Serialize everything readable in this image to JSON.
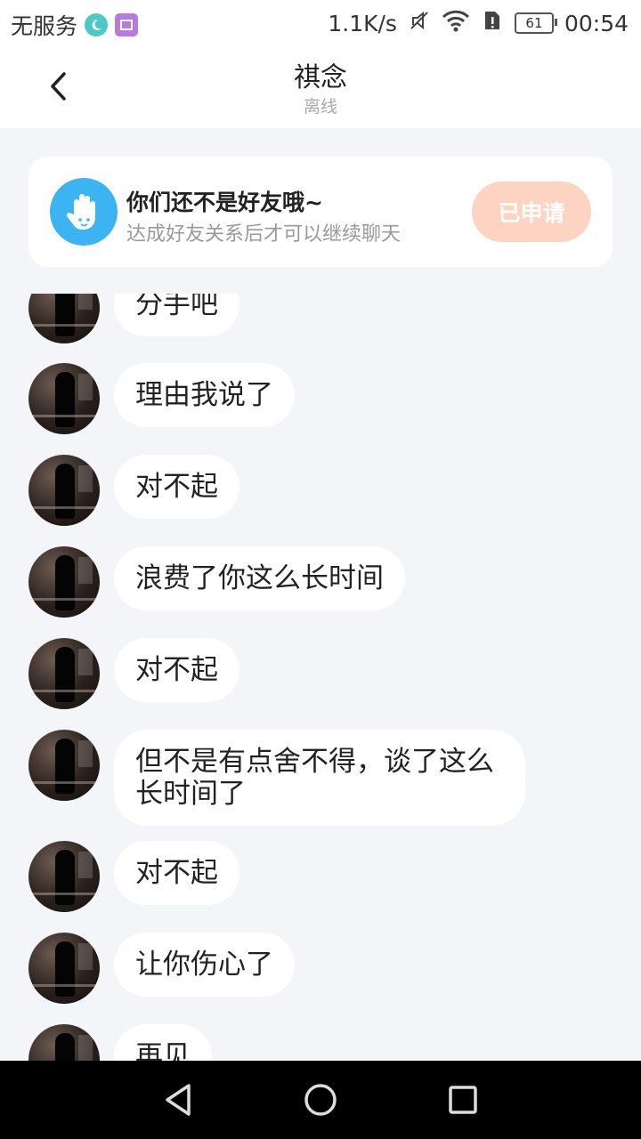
{
  "status_bar": {
    "carrier": "无服务",
    "speed": "1.1K/s",
    "battery": "61",
    "time": "00:54"
  },
  "header": {
    "title": "祺念",
    "subtitle": "离线"
  },
  "banner": {
    "title": "你们还不是好友哦~",
    "desc": "达成好友关系后才可以继续聊天",
    "button": "已申请"
  },
  "messages": [
    {
      "text": "分手吧"
    },
    {
      "text": "理由我说了"
    },
    {
      "text": "对不起"
    },
    {
      "text": "浪费了你这么长时间"
    },
    {
      "text": "对不起"
    },
    {
      "text": "但不是有点舍不得，谈了这么长时间了"
    },
    {
      "text": "对不起"
    },
    {
      "text": "让你伤心了"
    },
    {
      "text": "再见"
    }
  ],
  "colors": {
    "accent_blue": "#3db4f2",
    "applied_button": "#fdd4c2",
    "chat_bg": "#f3f5f8"
  }
}
